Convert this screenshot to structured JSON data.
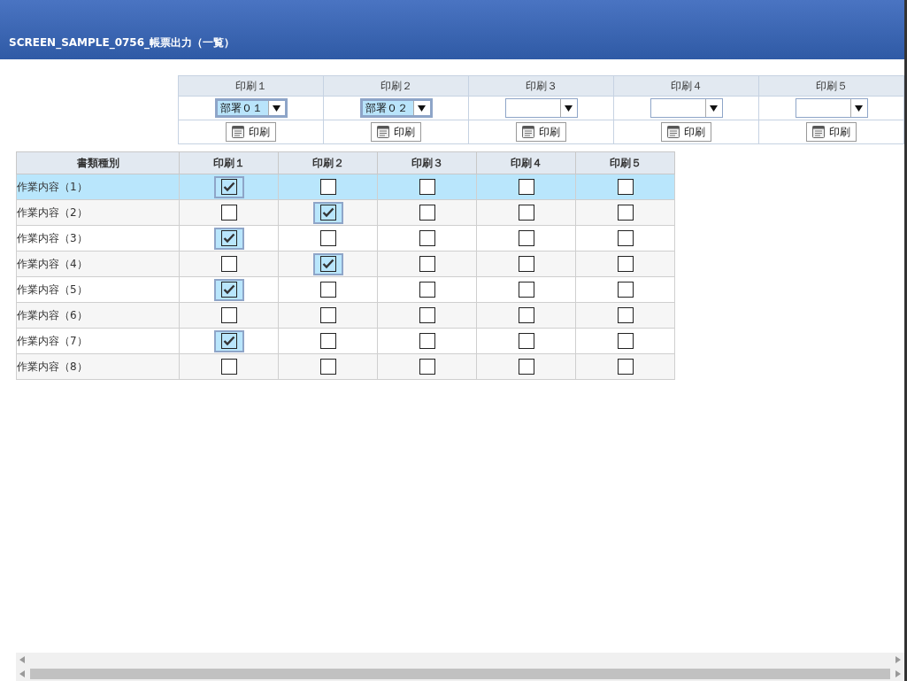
{
  "header": {
    "title": "SCREEN_SAMPLE_0756_帳票出力（一覧）"
  },
  "print_panel": {
    "columns": [
      {
        "label": "印刷１",
        "select_value": "部署０１",
        "button": "印刷"
      },
      {
        "label": "印刷２",
        "select_value": "部署０２",
        "button": "印刷"
      },
      {
        "label": "印刷３",
        "button": "印刷"
      },
      {
        "label": "印刷４",
        "button": "印刷"
      },
      {
        "label": "印刷５",
        "button": "印刷"
      }
    ]
  },
  "table": {
    "columns": [
      "書類種別",
      "印刷１",
      "印刷２",
      "印刷３",
      "印刷４",
      "印刷５"
    ],
    "rows": [
      {
        "label": "作業内容（1）",
        "selected": true,
        "checks": [
          true,
          false,
          false,
          false,
          false
        ]
      },
      {
        "label": "作業内容（2）",
        "selected": false,
        "checks": [
          false,
          true,
          false,
          false,
          false
        ]
      },
      {
        "label": "作業内容（3）",
        "selected": false,
        "checks": [
          true,
          false,
          false,
          false,
          false
        ]
      },
      {
        "label": "作業内容（4）",
        "selected": false,
        "checks": [
          false,
          true,
          false,
          false,
          false
        ]
      },
      {
        "label": "作業内容（5）",
        "selected": false,
        "checks": [
          true,
          false,
          false,
          false,
          false
        ]
      },
      {
        "label": "作業内容（6）",
        "selected": false,
        "checks": [
          false,
          false,
          false,
          false,
          false
        ]
      },
      {
        "label": "作業内容（7）",
        "selected": false,
        "checks": [
          true,
          false,
          false,
          false,
          false
        ]
      },
      {
        "label": "作業内容（8）",
        "selected": false,
        "checks": [
          false,
          false,
          false,
          false,
          false
        ]
      }
    ]
  }
}
